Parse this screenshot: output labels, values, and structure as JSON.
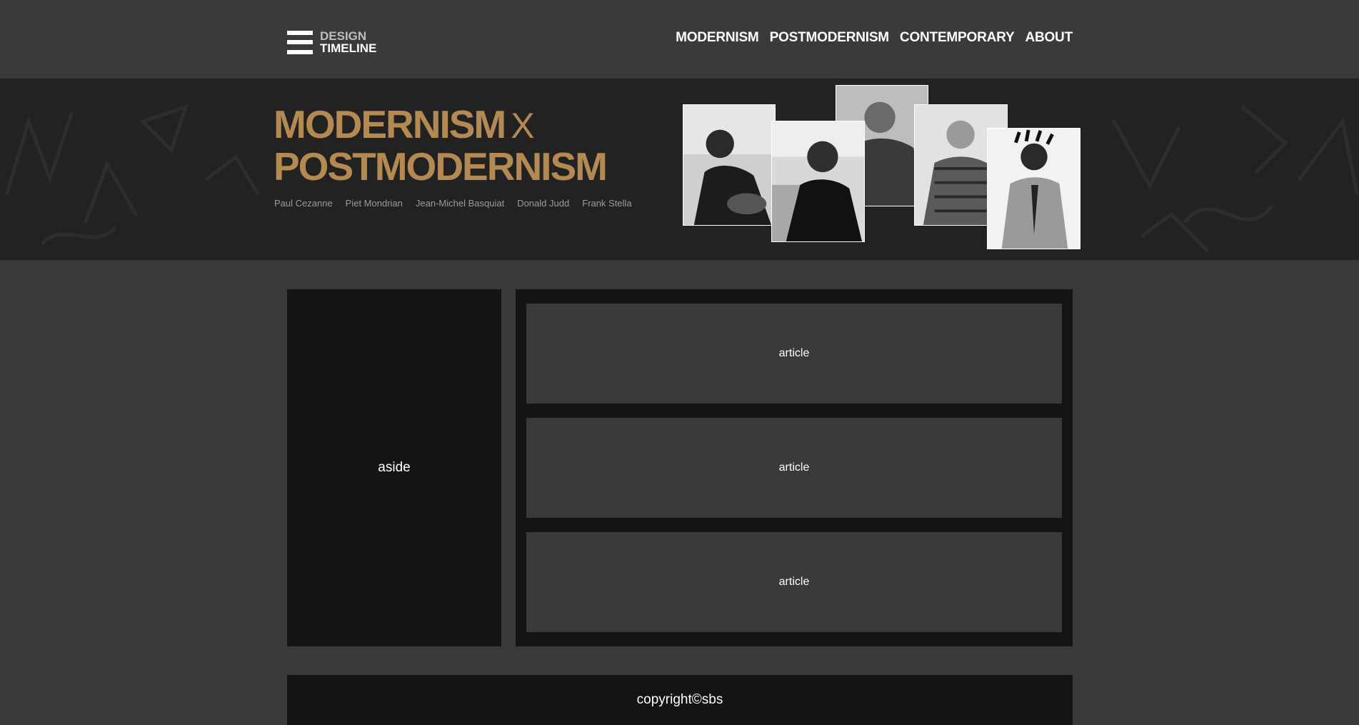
{
  "logo": {
    "line1": "DESIGN",
    "line2": "TIMELINE",
    "icon": "hamburger-icon"
  },
  "nav": {
    "items": [
      {
        "label": "MODERNISM"
      },
      {
        "label": "POSTMODERNISM"
      },
      {
        "label": "CONTEMPORARY"
      },
      {
        "label": "ABOUT"
      }
    ]
  },
  "banner": {
    "title_line1": "MODERNISM",
    "title_x": "X",
    "title_line2": "POSTMODERNISM",
    "artists": [
      "Paul Cezanne",
      "Piet Mondrian",
      "Jean-Michel Basquiat",
      "Donald Judd",
      "Frank Stella"
    ],
    "photos": [
      "portrait-photo",
      "portrait-photo",
      "portrait-photo",
      "portrait-photo",
      "portrait-photo"
    ]
  },
  "main": {
    "aside_label": "aside",
    "articles": [
      {
        "label": "article"
      },
      {
        "label": "article"
      },
      {
        "label": "article"
      }
    ]
  },
  "footer": {
    "text": "copyright©sbs"
  },
  "colors": {
    "accent": "#b48a52",
    "background": "#3b3a3b",
    "dark": "#141414",
    "banner": "#232223"
  }
}
